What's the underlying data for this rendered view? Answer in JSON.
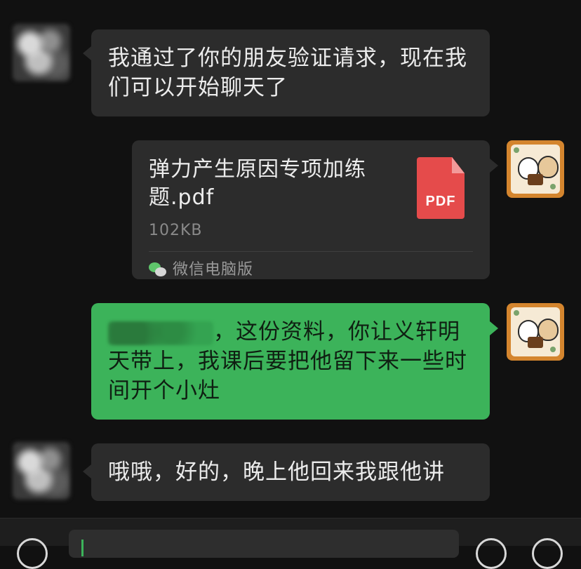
{
  "messages": [
    {
      "sender": "contact",
      "text": "我通过了你的朋友验证请求，现在我们可以开始聊天了"
    },
    {
      "sender": "me",
      "type": "file",
      "file_name": "弹力产生原因专项加练题.pdf",
      "file_size": "102KB",
      "file_badge": "PDF",
      "source": "微信电脑版"
    },
    {
      "sender": "me",
      "text": "，这份资料，你让义轩明天带上，我课后要把他留下来一些时间开个小灶"
    },
    {
      "sender": "contact",
      "text": "哦哦，好的，晚上他回来我跟他讲"
    }
  ],
  "colors": {
    "background": "#111111",
    "incoming_bubble": "#2c2c2c",
    "outgoing_bubble": "#3cb35a",
    "pdf_icon": "#e54b4b"
  },
  "icons": {
    "voice": "voice-icon",
    "emoji": "emoji-icon",
    "more": "plus-icon"
  }
}
